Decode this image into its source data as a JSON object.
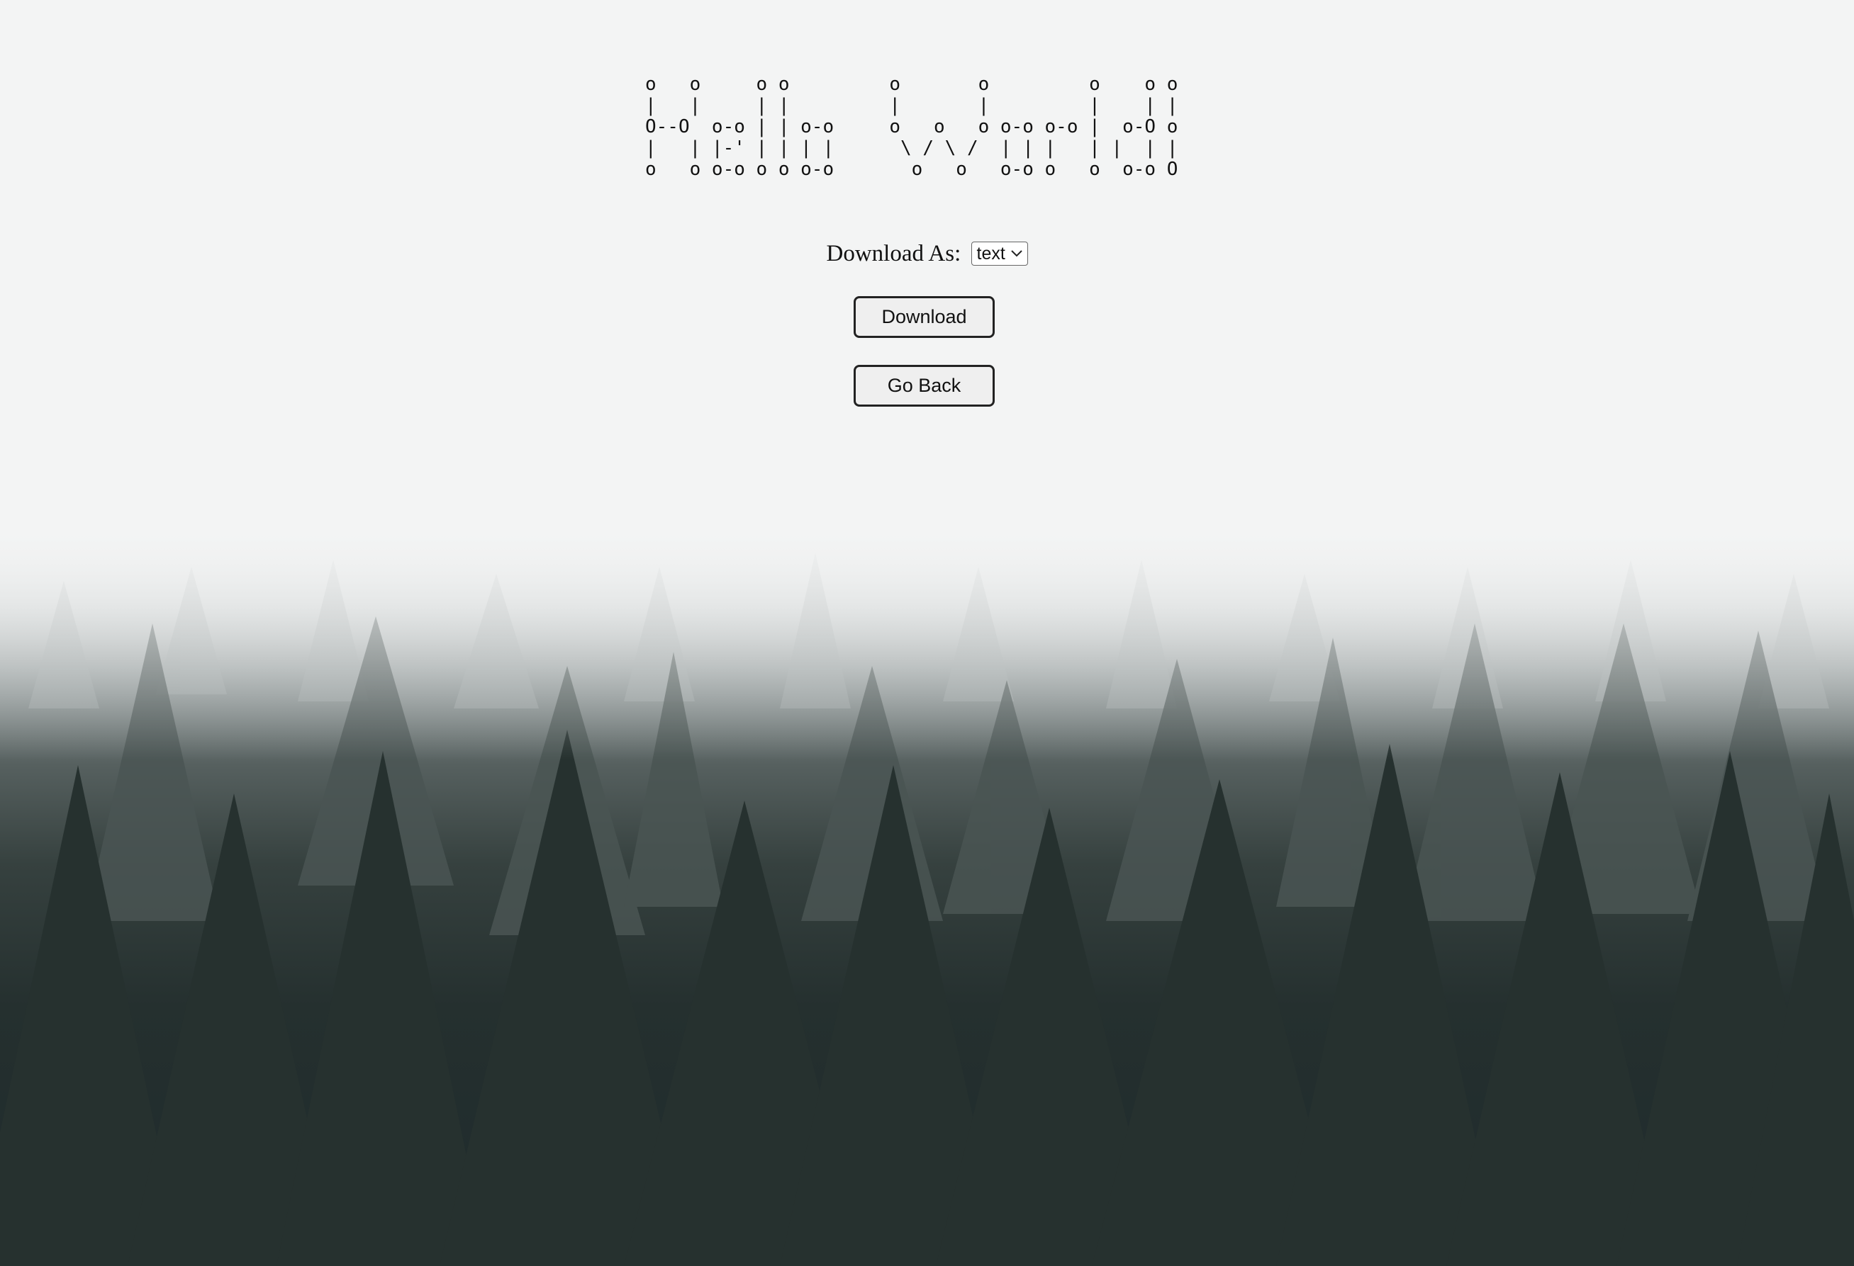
{
  "banner": {
    "ascii_art": "o   o     o o         o       o         o    o o\n|   |     | |         |       |         |    | |\nO--O  o-o | | o-o     o   o   o o-o o-o |  o-O o\n|   | |-' | | | |      \\ / \\ /  | | |   | |  | |\no   o o-o o o o-o       o   o   o-o o   o  o-o O"
  },
  "download": {
    "label": "Download As:",
    "format_selected": "text",
    "button_label": "Download"
  },
  "navigation": {
    "back_label": "Go Back"
  },
  "icons": {
    "select_arrow": "chevron-down-icon"
  },
  "colors": {
    "text": "#111111",
    "button_bg": "#efefef",
    "button_border": "#222222",
    "fog": "#f3f4f4",
    "forest_dark": "#1e2a2c"
  }
}
